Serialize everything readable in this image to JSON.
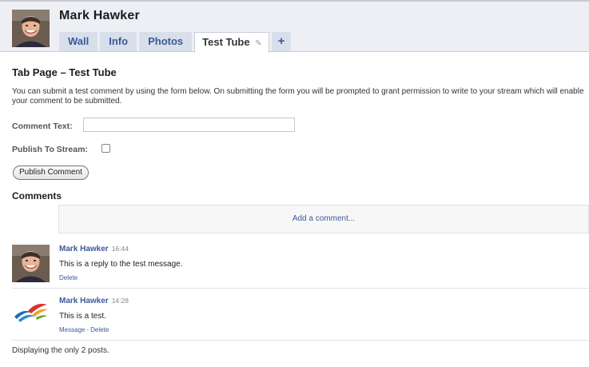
{
  "profile": {
    "name": "Mark Hawker"
  },
  "tabs": [
    {
      "label": "Wall"
    },
    {
      "label": "Info"
    },
    {
      "label": "Photos"
    },
    {
      "label": "Test Tube",
      "active": true,
      "icon": "pencil-icon"
    }
  ],
  "add_tab_label": "+",
  "page": {
    "title": "Tab Page – Test Tube",
    "intro": "You can submit a test comment by using the form below. On submitting the form you will be prompted to grant permission to write to your stream which will enable your comment to be submitted."
  },
  "form": {
    "comment_label": "Comment Text:",
    "comment_value": "",
    "publish_label": "Publish To Stream:",
    "publish_checked": false,
    "submit_label": "Publish Comment"
  },
  "comments": {
    "heading": "Comments",
    "add_placeholder": "Add a comment...",
    "posts": [
      {
        "author": "Mark Hawker",
        "time": "16:44",
        "text": "This is a reply to the test message.",
        "actions": [
          "Delete"
        ],
        "avatar": "profile-photo"
      },
      {
        "author": "Mark Hawker",
        "time": "14:28",
        "text": "This is a test.",
        "actions": [
          "Message",
          "Delete"
        ],
        "avatar": "app-logo"
      }
    ],
    "footer": "Displaying the only 2 posts."
  },
  "colors": {
    "link": "#3b5998",
    "tab_bg": "#d8dfea",
    "header_bg": "#edeff4"
  }
}
